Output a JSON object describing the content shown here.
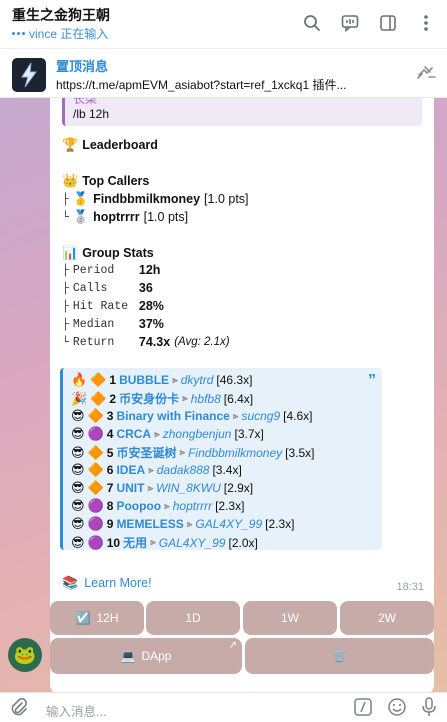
{
  "header": {
    "title": "重生之金狗王朝",
    "status": "vince 正在输入",
    "icons": [
      "search-icon",
      "chat-icon",
      "sidebar-icon",
      "more-icon"
    ]
  },
  "pinned": {
    "title": "置顶消息",
    "text": "https://t.me/apmEVM_asiabot?start=ref_1xckq1 插件..."
  },
  "message": {
    "quote_name": "长柒",
    "quote_text": "/lb 12h",
    "leaderboard_title": "Leaderboard",
    "top_callers_title": "Top Callers",
    "callers": [
      {
        "prefix": "├",
        "medal": "🥇",
        "name": "Findbbmilkmoney",
        "pts": "[1.0 pts]"
      },
      {
        "prefix": "└",
        "medal": "🥈",
        "name": "hoptrrrr",
        "pts": "[1.0 pts]"
      }
    ],
    "group_stats_title": "Group Stats",
    "stats": [
      {
        "prefix": "├",
        "label": "Period",
        "value": "12h",
        "extra": ""
      },
      {
        "prefix": "├",
        "label": "Calls",
        "value": "36",
        "extra": ""
      },
      {
        "prefix": "├",
        "label": "Hit Rate",
        "value": "28%",
        "extra": ""
      },
      {
        "prefix": "├",
        "label": "Median",
        "value": "37%",
        "extra": ""
      },
      {
        "prefix": "└",
        "label": "Return",
        "value": "74.3x",
        "extra": "(Avg: 2.1x)"
      }
    ],
    "board": [
      {
        "emoji": "🔥",
        "diamond": "🔶",
        "rank": "1",
        "token": "BUBBLE",
        "user": "dkytrd",
        "mult": "[46.3x]"
      },
      {
        "emoji": "🎉",
        "diamond": "🔶",
        "rank": "2",
        "token": "币安身份卡",
        "user": "hbfb8",
        "mult": "[6.4x]"
      },
      {
        "emoji": "😎",
        "diamond": "🔶",
        "rank": "3",
        "token": "Binary with Finance",
        "user": "sucng9",
        "mult": "[4.6x]"
      },
      {
        "emoji": "😎",
        "diamond": "🟣",
        "rank": "4",
        "token": "CRCA",
        "user": "zhongbenjun",
        "mult": "[3.7x]"
      },
      {
        "emoji": "😎",
        "diamond": "🔶",
        "rank": "5",
        "token": "币安圣诞树",
        "user": "Findbbmilkmoney",
        "mult": "[3.5x]"
      },
      {
        "emoji": "😎",
        "diamond": "🔶",
        "rank": "6",
        "token": "IDEA",
        "user": "dadak888",
        "mult": "[3.4x]"
      },
      {
        "emoji": "😎",
        "diamond": "🔶",
        "rank": "7",
        "token": "UNIT",
        "user": "WIN_8KWU",
        "mult": "[2.9x]"
      },
      {
        "emoji": "😎",
        "diamond": "🟣",
        "rank": "8",
        "token": "Poopoo",
        "user": "hoptrrrr",
        "mult": "[2.3x]"
      },
      {
        "emoji": "😎",
        "diamond": "🟣",
        "rank": "9",
        "token": "MEMELESS",
        "user": "GAL4XY_99",
        "mult": "[2.3x]"
      },
      {
        "emoji": "😎",
        "diamond": "🟣",
        "rank": "10",
        "token": "无用",
        "user": "GAL4XY_99",
        "mult": "[2.0x]"
      }
    ],
    "learn_more": "Learn More!",
    "time": "18:31"
  },
  "keyboard": {
    "row1": [
      "12H",
      "1D",
      "1W",
      "2W"
    ],
    "dapp": "DApp",
    "trash_icon": "trash-icon"
  },
  "input": {
    "placeholder": "输入消息..."
  }
}
